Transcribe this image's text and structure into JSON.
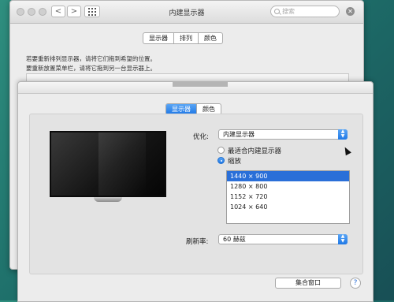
{
  "back_window": {
    "title": "内建显示器",
    "search_placeholder": "搜索",
    "nav_back": "<",
    "nav_forward": ">",
    "close_label": "✕",
    "tabs": [
      {
        "label": "显示器"
      },
      {
        "label": "排列",
        "active": true
      },
      {
        "label": "颜色"
      }
    ],
    "instruction_1": "若要重新排列显示器，请将它们拖到希望的位置。",
    "instruction_2": "要重新放置菜单栏，请将它拖到另一台显示器上。"
  },
  "front_window": {
    "tabs": [
      {
        "label": "显示器",
        "active": true
      },
      {
        "label": "颜色"
      }
    ],
    "optimize": {
      "label": "优化:",
      "selected": "内建显示器"
    },
    "resolution_options": {
      "best": "最适合内建显示器",
      "scaled": "缩放",
      "selected_option": "scaled"
    },
    "resolutions": [
      {
        "value": "1440 × 900",
        "selected": true
      },
      {
        "value": "1280 × 800"
      },
      {
        "value": "1152 × 720"
      },
      {
        "value": "1024 × 640"
      }
    ],
    "refresh": {
      "label": "刷新率:",
      "selected": "60 赫兹"
    },
    "gather_windows_label": "集合窗口",
    "help_label": "?"
  },
  "colors": {
    "accent_blue": "#1f78e6",
    "selection_blue": "#2a6fd8",
    "window_bg": "#ececec"
  }
}
